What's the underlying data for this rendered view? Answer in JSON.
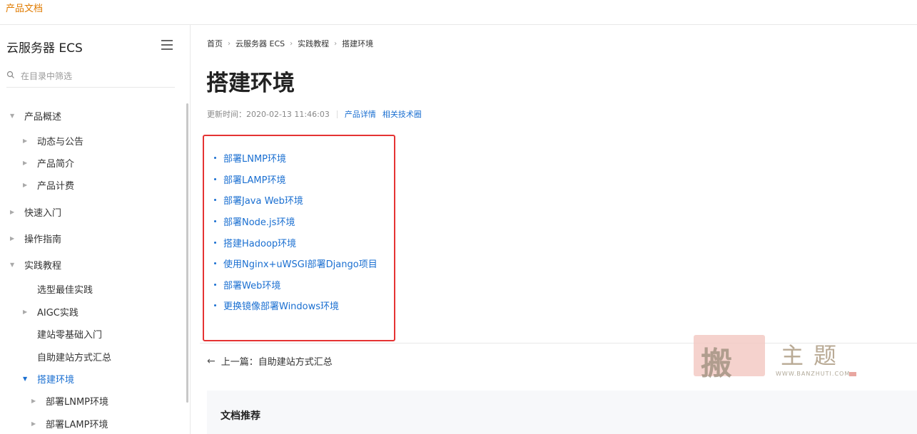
{
  "topbar": {
    "label": "产品文档"
  },
  "sidebar": {
    "title": "云服务器 ECS",
    "filter_placeholder": "在目录中筛选",
    "items": [
      {
        "label": "产品概述",
        "level": 0,
        "expanded": true,
        "active": false
      },
      {
        "label": "动态与公告",
        "level": 1,
        "expanded": false,
        "active": false
      },
      {
        "label": "产品简介",
        "level": 1,
        "expanded": false,
        "active": false
      },
      {
        "label": "产品计费",
        "level": 1,
        "expanded": false,
        "active": false
      },
      {
        "label": "快速入门",
        "level": 0,
        "expanded": false,
        "active": false
      },
      {
        "label": "操作指南",
        "level": 0,
        "expanded": false,
        "active": false
      },
      {
        "label": "实践教程",
        "level": 0,
        "expanded": true,
        "active": false
      },
      {
        "label": "选型最佳实践",
        "level": 1,
        "expanded": null,
        "active": false
      },
      {
        "label": "AIGC实践",
        "level": 1,
        "expanded": false,
        "active": false
      },
      {
        "label": "建站零基础入门",
        "level": 1,
        "expanded": null,
        "active": false
      },
      {
        "label": "自助建站方式汇总",
        "level": 1,
        "expanded": null,
        "active": false
      },
      {
        "label": "搭建环境",
        "level": 1,
        "expanded": true,
        "active": true
      },
      {
        "label": "部署LNMP环境",
        "level": 2,
        "expanded": false,
        "active": false
      },
      {
        "label": "部署LAMP环境",
        "level": 2,
        "expanded": false,
        "active": false
      }
    ]
  },
  "main": {
    "breadcrumb": [
      "首页",
      "云服务器 ECS",
      "实践教程",
      "搭建环境"
    ],
    "title": "搭建环境",
    "updated_label": "更新时间：2020-02-13 11:46:03",
    "meta_links": [
      "产品详情",
      "相关技术圈"
    ],
    "links": [
      "部署LNMP环境",
      "部署LAMP环境",
      "部署Java Web环境",
      "部署Node.js环境",
      "搭建Hadoop环境",
      "使用Nginx+uWSGI部署Django项目",
      "部署Web环境",
      "更换镜像部署Windows环境"
    ],
    "prev_label": "上一篇：自助建站方式汇总",
    "recommend_title": "文档推荐"
  },
  "watermark": {
    "chars": "主题",
    "url": "WWW.BANZHUTI.COM"
  },
  "colors": {
    "link": "#1a6fd1",
    "highlight_border": "#e53333",
    "topbar_label": "#e07b00"
  }
}
